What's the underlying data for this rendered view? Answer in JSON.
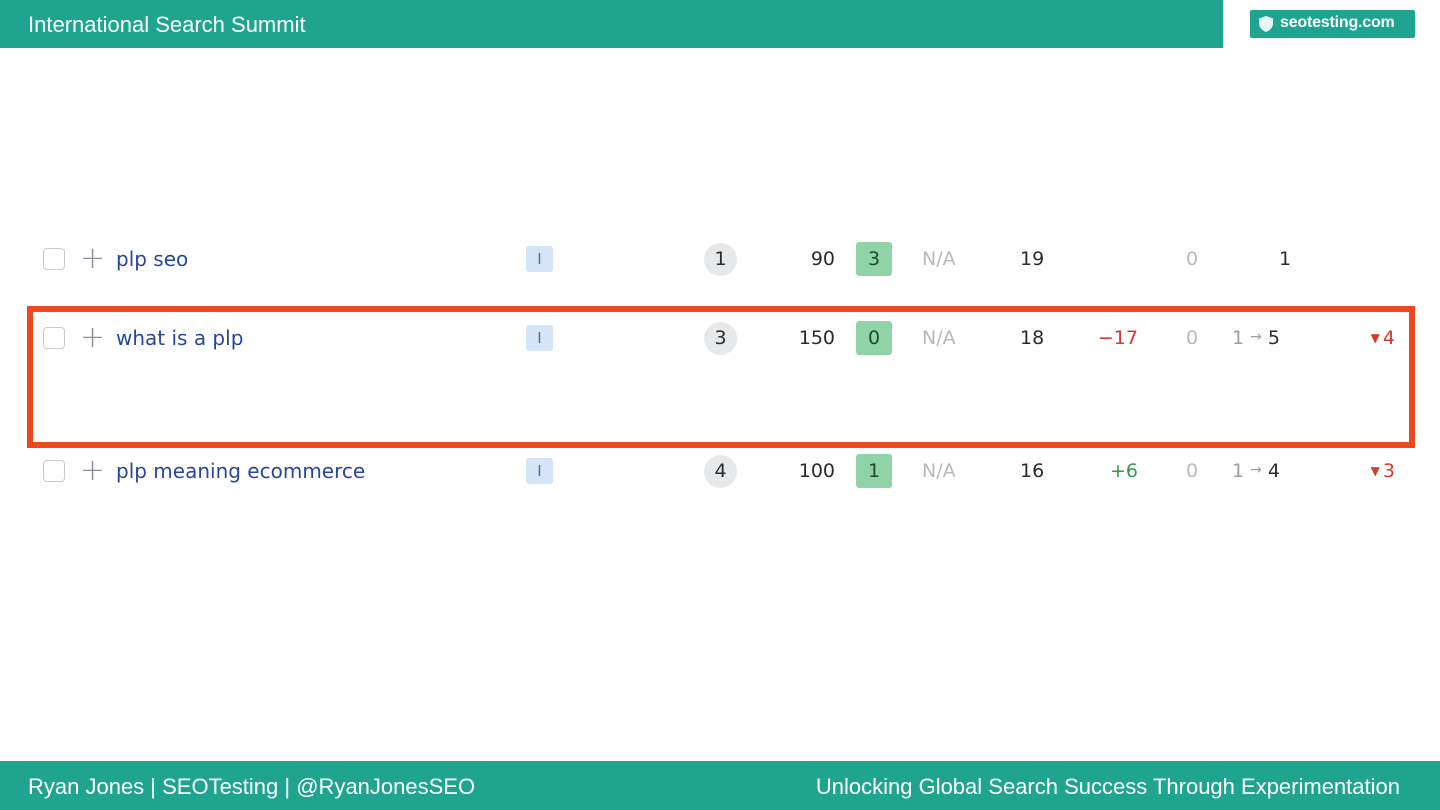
{
  "header": {
    "title": "International Search Summit",
    "logo_text": "seotesting.com"
  },
  "footer": {
    "left": "Ryan Jones | SEOTesting | @RyanJonesSEO",
    "right": "Unlocking Global Search Success Through Experimentation"
  },
  "rows": [
    {
      "keyword": "plp seo",
      "intent": "I",
      "position": "1",
      "volume": "90",
      "kd": "3",
      "cpc": "N/A",
      "serp": "19",
      "change": "",
      "zero": "0",
      "range_from": "",
      "range_arrow": "",
      "range_to": "1",
      "drop": ""
    },
    {
      "keyword": "what is a plp",
      "intent": "I",
      "position": "3",
      "volume": "150",
      "kd": "0",
      "cpc": "N/A",
      "serp": "18",
      "change": "−17",
      "zero": "0",
      "range_from": "1",
      "range_arrow": "→",
      "range_to": "5",
      "drop": "4"
    },
    {
      "keyword": "plp meaning ecommerce",
      "intent": "I",
      "position": "4",
      "volume": "100",
      "kd": "1",
      "cpc": "N/A",
      "serp": "16",
      "change": "+6",
      "zero": "0",
      "range_from": "1",
      "range_arrow": "→",
      "range_to": "4",
      "drop": "3"
    }
  ],
  "colors": {
    "brand": "#1fa58f",
    "highlight": "#f0481e",
    "negative": "#d43a2f",
    "positive": "#3a9a4c"
  }
}
